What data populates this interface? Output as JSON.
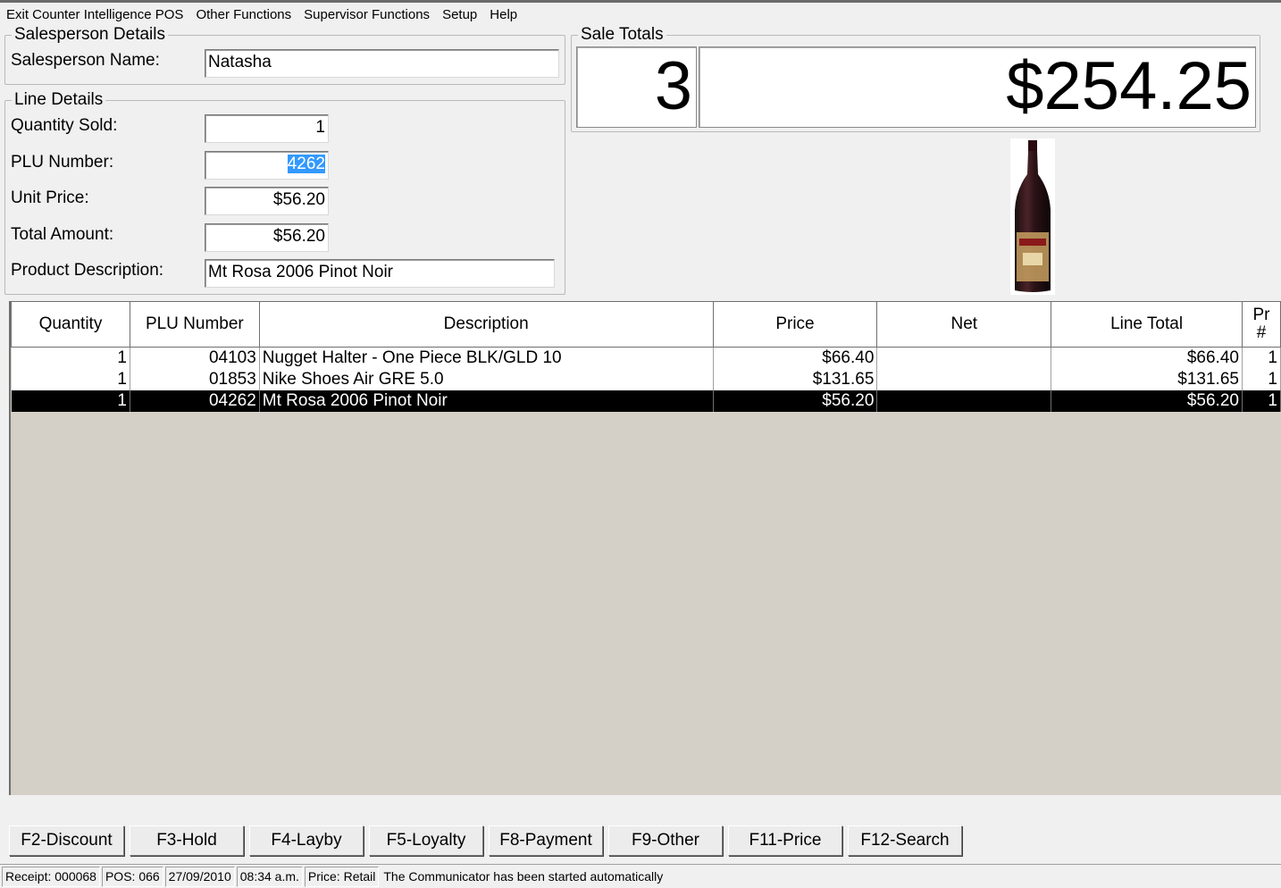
{
  "menu": [
    "Exit Counter Intelligence POS",
    "Other Functions",
    "Supervisor Functions",
    "Setup",
    "Help"
  ],
  "salesperson": {
    "group_title": "Salesperson Details",
    "name_label": "Salesperson Name:",
    "name_value": "Natasha"
  },
  "line_details": {
    "group_title": "Line Details",
    "quantity_label": "Quantity Sold:",
    "quantity_value": "1",
    "plu_label": "PLU Number:",
    "plu_value": "4262",
    "unit_price_label": "Unit Price:",
    "unit_price_value": "$56.20",
    "total_label": "Total Amount:",
    "total_value": "$56.20",
    "description_label": "Product Description:",
    "description_value": "Mt Rosa 2006 Pinot Noir"
  },
  "sale_totals": {
    "group_title": "Sale Totals",
    "item_count": "3",
    "total": "$254.25"
  },
  "product_image": {
    "icon": "wine-bottle",
    "label_color": "#c8a060"
  },
  "table": {
    "columns": [
      "Quantity",
      "PLU Number",
      "Description",
      "Price",
      "Net",
      "Line Total",
      "Pr #"
    ],
    "rows": [
      {
        "qty": "1",
        "plu": "04103",
        "desc": "Nugget Halter - One Piece BLK/GLD 10",
        "price": "$66.40",
        "net": "",
        "total": "$66.40",
        "pr": "1"
      },
      {
        "qty": "1",
        "plu": "01853",
        "desc": "Nike Shoes Air GRE 5.0",
        "price": "$131.65",
        "net": "",
        "total": "$131.65",
        "pr": "1"
      },
      {
        "qty": "1",
        "plu": "04262",
        "desc": "Mt Rosa 2006 Pinot Noir",
        "price": "$56.20",
        "net": "",
        "total": "$56.20",
        "pr": "1"
      }
    ],
    "selected_row": 2
  },
  "function_keys": [
    "F2-Discount",
    "F3-Hold",
    "F4-Layby",
    "F5-Loyalty",
    "F8-Payment",
    "F9-Other",
    "F11-Price",
    "F12-Search"
  ],
  "status": {
    "receipt": "Receipt: 000068",
    "pos": "POS: 066",
    "date": "27/09/2010",
    "time": "08:34 a.m.",
    "price": "Price: Retail",
    "message": "The Communicator has been started automatically"
  }
}
